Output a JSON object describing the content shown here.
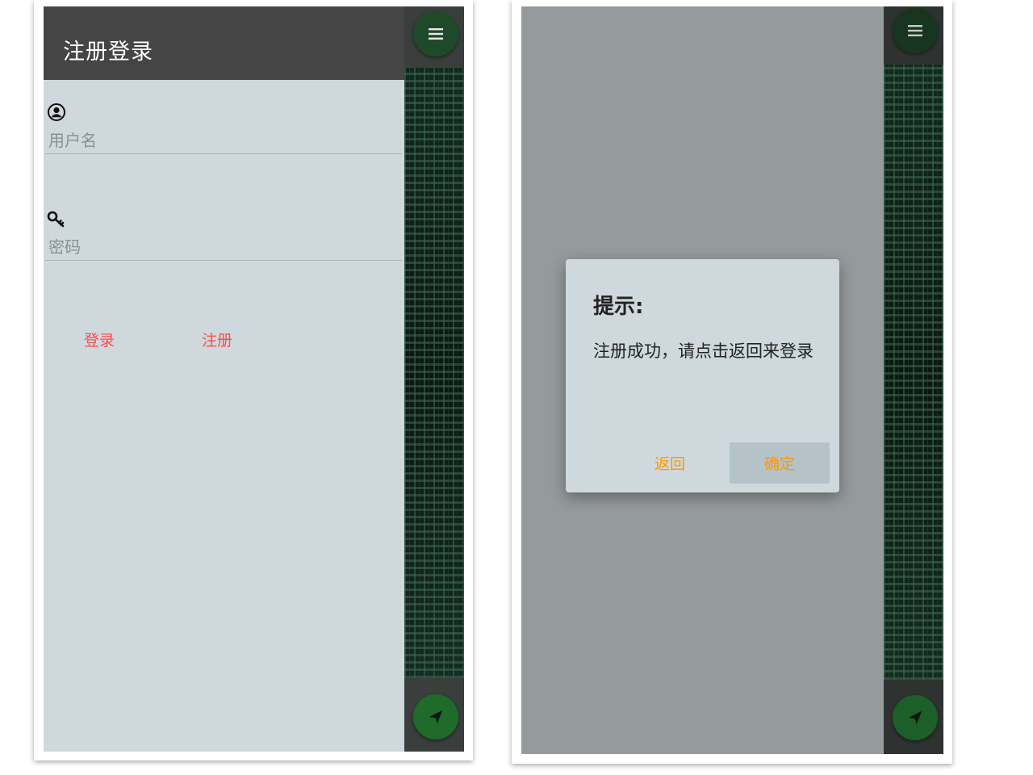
{
  "colors": {
    "header_bg": "#454545",
    "form_bg": "#cfd8dc",
    "button_text": "#ff4b4b",
    "fab_green": "#1e5e2a",
    "dialog_button_text": "#ff9800",
    "dim_overlay": "#959a9c"
  },
  "left_screen": {
    "header": {
      "title": "注册登录"
    },
    "username": {
      "icon": "user-circle-icon",
      "placeholder": "用户名"
    },
    "password": {
      "icon": "key-icon",
      "placeholder": "密码"
    },
    "buttons": {
      "login": "登录",
      "register": "注册"
    },
    "fab_top_icon": "menu-icon",
    "fab_bottom_icon": "send-icon"
  },
  "right_screen": {
    "dialog": {
      "title": "提示:",
      "message": "注册成功，请点击返回来登录",
      "cancel": "返回",
      "confirm": "确定"
    },
    "fab_top_icon": "menu-icon",
    "fab_bottom_icon": "send-icon"
  }
}
